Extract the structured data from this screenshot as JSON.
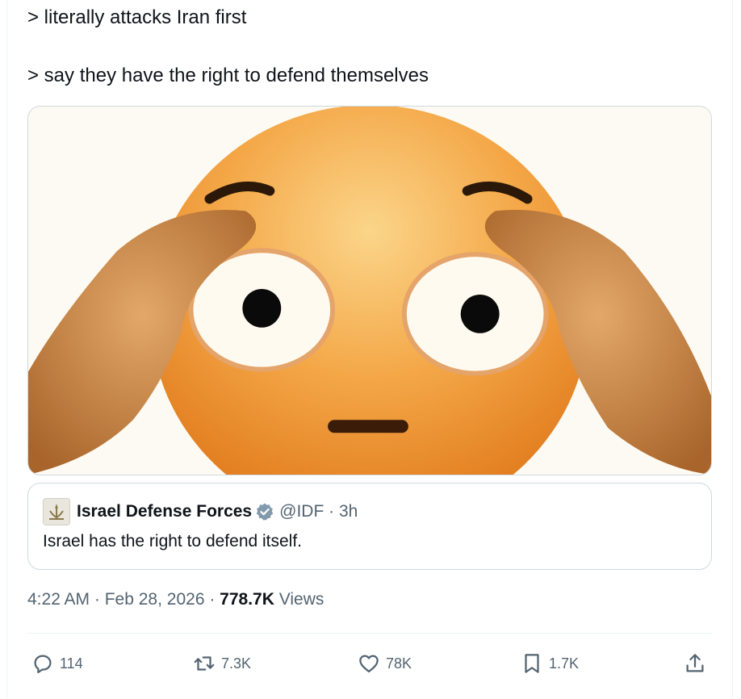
{
  "tweet": {
    "line1": "> literally attacks Iran first",
    "line2": "> say they have the right to defend themselves",
    "media_icon": "flushed-emoji-face-with-hands"
  },
  "quote": {
    "avatar_icon": "idf-emblem-icon",
    "name": "Israel Defense Forces",
    "verified_icon": "gray-verified-badge-icon",
    "handle": "@IDF",
    "separator": "·",
    "age": "3h",
    "text": "Israel has the right to defend itself."
  },
  "meta": {
    "time": "4:22 AM",
    "sep1": " · ",
    "date": "Feb 28, 2026",
    "sep2": " · ",
    "views_count": "778.7K",
    "views_label": " Views"
  },
  "actions": {
    "reply_count": "114",
    "retweet_count": "7.3K",
    "like_count": "78K",
    "bookmark_count": "1.7K"
  },
  "colors": {
    "text_primary": "#0f1419",
    "text_secondary": "#536471",
    "border": "#cfd9de"
  }
}
